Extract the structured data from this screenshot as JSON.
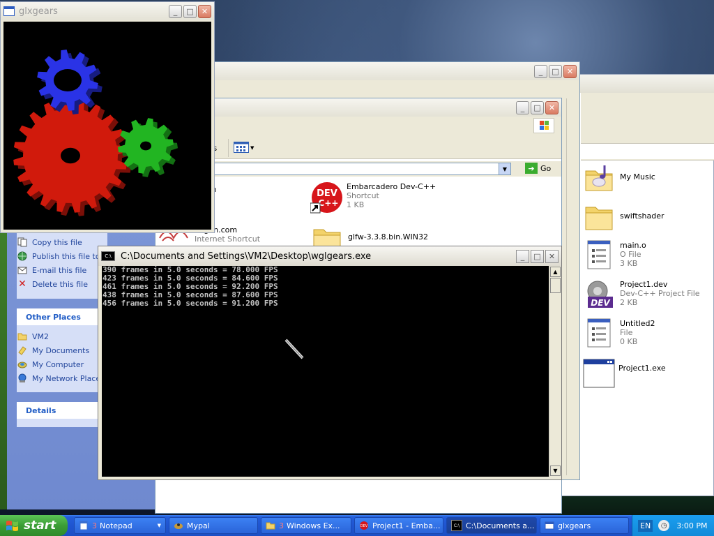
{
  "back_explorer": {
    "files": [
      {
        "name": "My Music",
        "sub1": "",
        "sub2": ""
      },
      {
        "name": "swiftshader",
        "sub1": "",
        "sub2": ""
      },
      {
        "name": "main.o",
        "sub1": "O File",
        "sub2": "3 KB"
      },
      {
        "name": "Project1.dev",
        "sub1": "Dev-C++ Project File",
        "sub2": "2 KB"
      },
      {
        "name": "Untitled2",
        "sub1": "File",
        "sub2": "0 KB"
      },
      {
        "name": "Project1.exe",
        "sub1": "",
        "sub2": ""
      }
    ]
  },
  "front_explorer": {
    "toolbar_partial": "rs",
    "go_label": "Go",
    "items": [
      {
        "name": "mium",
        "sub1": "rtcut",
        "sub2": ""
      },
      {
        "name": "Embarcadero Dev-C++",
        "sub1": "Shortcut",
        "sub2": "1 KB"
      },
      {
        "name": "Vagon.com",
        "sub1": "Internet Shortcut",
        "sub2": ""
      },
      {
        "name": "glfw-3.3.8.bin.WIN32",
        "sub1": "",
        "sub2": ""
      }
    ]
  },
  "task_pane": {
    "file_tasks": [
      "Copy this file",
      "Publish this file to",
      "E-mail this file",
      "Delete this file"
    ],
    "other_places_title": "Other Places",
    "other_places": [
      "VM2",
      "My Documents",
      "My Computer",
      "My Network Places"
    ],
    "details_title": "Details"
  },
  "glxgears": {
    "title": "glxgears"
  },
  "console": {
    "title": "C:\\Documents and Settings\\VM2\\Desktop\\wglgears.exe",
    "lines": [
      "390 frames in 5.0 seconds = 78.000 FPS",
      "423 frames in 5.0 seconds = 84.600 FPS",
      "461 frames in 5.0 seconds = 92.200 FPS",
      "438 frames in 5.0 seconds = 87.600 FPS",
      "456 frames in 5.0 seconds = 91.200 FPS"
    ]
  },
  "taskbar": {
    "start_label": "start",
    "buttons": [
      {
        "label": "Notepad",
        "count": "3",
        "icon": "notepad-icon"
      },
      {
        "label": "Mypal",
        "count": "",
        "icon": "mypal-icon"
      },
      {
        "label": "Windows Ex...",
        "count": "3",
        "icon": "folder-icon"
      },
      {
        "label": "Project1 - Emba...",
        "count": "",
        "icon": "devcpp-icon"
      },
      {
        "label": "C:\\Documents a...",
        "count": "",
        "icon": "console-icon"
      },
      {
        "label": "glxgears",
        "count": "",
        "icon": "window-icon"
      }
    ],
    "language": "EN",
    "clock": "3:00 PM"
  },
  "colors": {
    "taskbar_blue": "#245edb",
    "start_green": "#3b9d35",
    "gear_red": "#d11a0c",
    "gear_green": "#22b522",
    "gear_blue": "#2a33e6"
  }
}
